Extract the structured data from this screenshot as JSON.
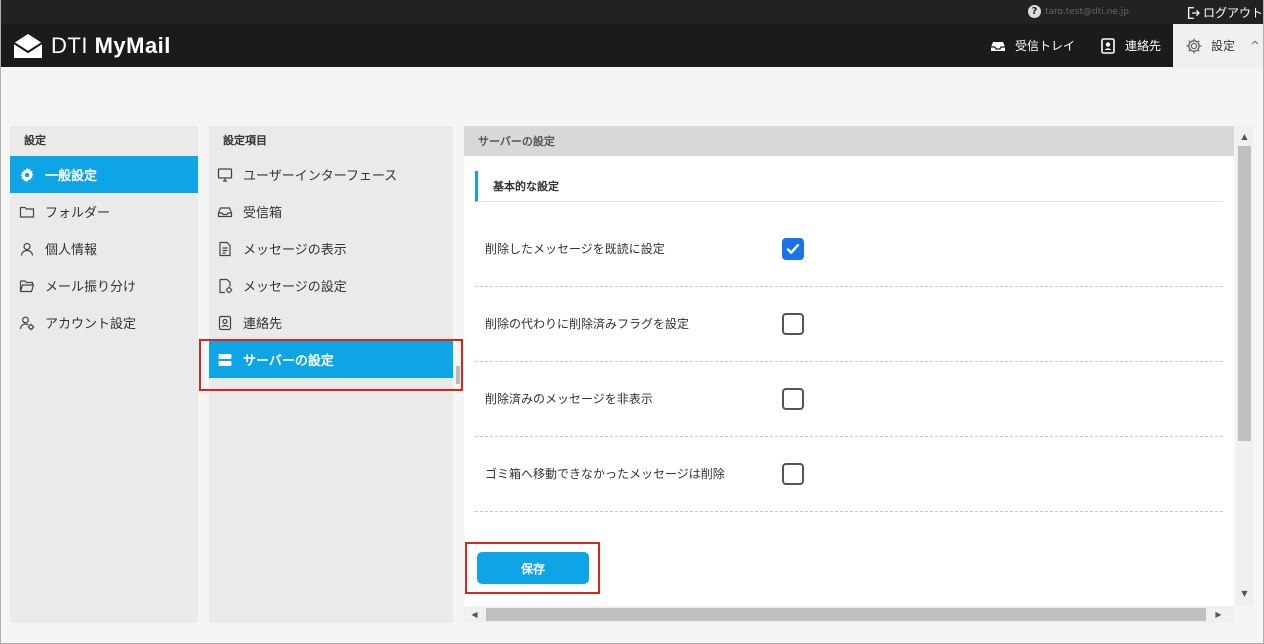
{
  "topbar": {
    "help_label": "?",
    "user_email": "taro.test@dti.ne.jp",
    "logout_label": "ログアウト"
  },
  "header": {
    "logo_light": "DTI ",
    "logo_bold": "MyMail",
    "nav": [
      {
        "label": "受信トレイ",
        "icon": "inbox-icon"
      },
      {
        "label": "連絡先",
        "icon": "contact-icon"
      },
      {
        "label": "設定",
        "icon": "gear-icon"
      }
    ],
    "collapse_glyph": "^"
  },
  "sidebar": {
    "title": "設定",
    "items": [
      {
        "label": "一般設定",
        "icon": "gear-icon",
        "active": true
      },
      {
        "label": "フォルダー",
        "icon": "folder-icon"
      },
      {
        "label": "個人情報",
        "icon": "person-icon"
      },
      {
        "label": "メール振り分け",
        "icon": "folder-open-icon"
      },
      {
        "label": "アカウント設定",
        "icon": "account-icon"
      }
    ]
  },
  "settings_menu": {
    "title": "設定項目",
    "items": [
      {
        "label": "ユーザーインターフェース",
        "icon": "monitor-icon"
      },
      {
        "label": "受信箱",
        "icon": "inbox-icon"
      },
      {
        "label": "メッセージの表示",
        "icon": "document-icon"
      },
      {
        "label": "メッセージの設定",
        "icon": "document-gear-icon"
      },
      {
        "label": "連絡先",
        "icon": "contact-icon"
      },
      {
        "label": "サーバーの設定",
        "icon": "server-icon",
        "active": true
      }
    ]
  },
  "main": {
    "title": "サーバーの設定",
    "section_title": "基本的な設定",
    "settings": [
      {
        "label": "削除したメッセージを既読に設定",
        "checked": true
      },
      {
        "label": "削除の代わりに削除済みフラグを設定",
        "checked": false
      },
      {
        "label": "削除済みのメッセージを非表示",
        "checked": false
      },
      {
        "label": "ゴミ箱へ移動できなかったメッセージは削除",
        "checked": false
      }
    ],
    "save_label": "保存"
  },
  "colors": {
    "accent": "#0ea5e6",
    "checkbox_checked": "#1a73e8",
    "highlight": "#d9261c",
    "header_bg": "#1b1b1b"
  }
}
